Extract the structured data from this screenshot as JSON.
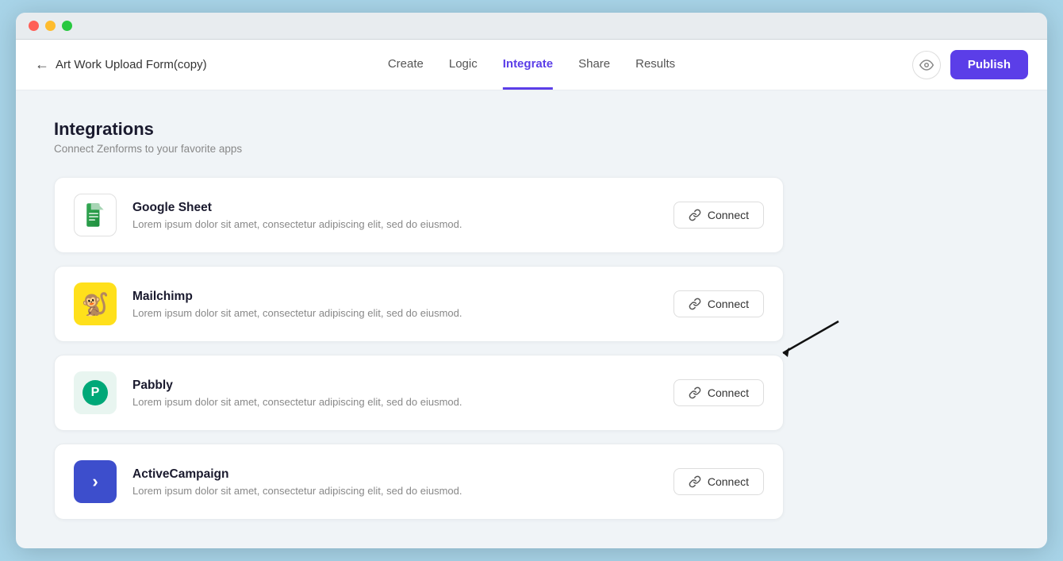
{
  "window": {
    "title": "Art Work Upload Form(copy)"
  },
  "header": {
    "back_label": "←",
    "form_title": "Art Work Upload Form(copy)",
    "nav_tabs": [
      {
        "id": "create",
        "label": "Create",
        "active": false
      },
      {
        "id": "logic",
        "label": "Logic",
        "active": false
      },
      {
        "id": "integrate",
        "label": "Integrate",
        "active": true
      },
      {
        "id": "share",
        "label": "Share",
        "active": false
      },
      {
        "id": "results",
        "label": "Results",
        "active": false
      }
    ],
    "publish_label": "Publish"
  },
  "page": {
    "title": "Integrations",
    "subtitle": "Connect Zenforms to your favorite apps"
  },
  "integrations": [
    {
      "id": "google-sheet",
      "name": "Google Sheet",
      "description": "Lorem ipsum dolor sit amet, consectetur adipiscing elit, sed do eiusmod.",
      "connect_label": "Connect",
      "icon_type": "gsheet"
    },
    {
      "id": "mailchimp",
      "name": "Mailchimp",
      "description": "Lorem ipsum dolor sit amet, consectetur adipiscing elit, sed do eiusmod.",
      "connect_label": "Connect",
      "icon_type": "mailchimp"
    },
    {
      "id": "pabbly",
      "name": "Pabbly",
      "description": "Lorem ipsum dolor sit amet, consectetur adipiscing elit, sed do eiusmod.",
      "connect_label": "Connect",
      "icon_type": "pabbly"
    },
    {
      "id": "activecampaign",
      "name": "ActiveCampaign",
      "description": "Lorem ipsum dolor sit amet, consectetur adipiscing elit, sed do eiusmod.",
      "connect_label": "Connect",
      "icon_type": "activecampaign"
    }
  ],
  "colors": {
    "accent": "#5b3ee8",
    "publish_bg": "#5b3ee8"
  }
}
